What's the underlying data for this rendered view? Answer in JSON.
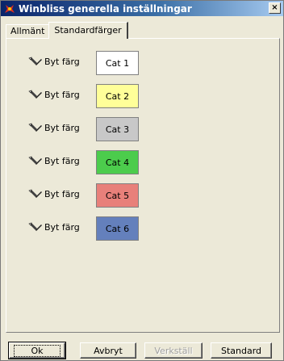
{
  "window": {
    "title": "Winbliss generella inställningar",
    "close_label": "×"
  },
  "tabs": [
    {
      "label": "Allmänt",
      "active": false
    },
    {
      "label": "Standardfärger",
      "active": true
    }
  ],
  "color_rows": [
    {
      "button_label": "Byt färg",
      "swatch_label": "Cat 1",
      "color": "#ffffff"
    },
    {
      "button_label": "Byt färg",
      "swatch_label": "Cat 2",
      "color": "#ffff99"
    },
    {
      "button_label": "Byt färg",
      "swatch_label": "Cat 3",
      "color": "#c8c8c8"
    },
    {
      "button_label": "Byt färg",
      "swatch_label": "Cat 4",
      "color": "#4ccc4c"
    },
    {
      "button_label": "Byt färg",
      "swatch_label": "Cat 5",
      "color": "#e8807a"
    },
    {
      "button_label": "Byt färg",
      "swatch_label": "Cat 6",
      "color": "#6480bc"
    }
  ],
  "buttons": {
    "ok": "Ok",
    "cancel": "Avbryt",
    "apply": "Verkställ",
    "default": "Standard"
  },
  "colors": {
    "title_gradient_start": "#0a246a",
    "dialog_bg": "#ece9d8"
  }
}
